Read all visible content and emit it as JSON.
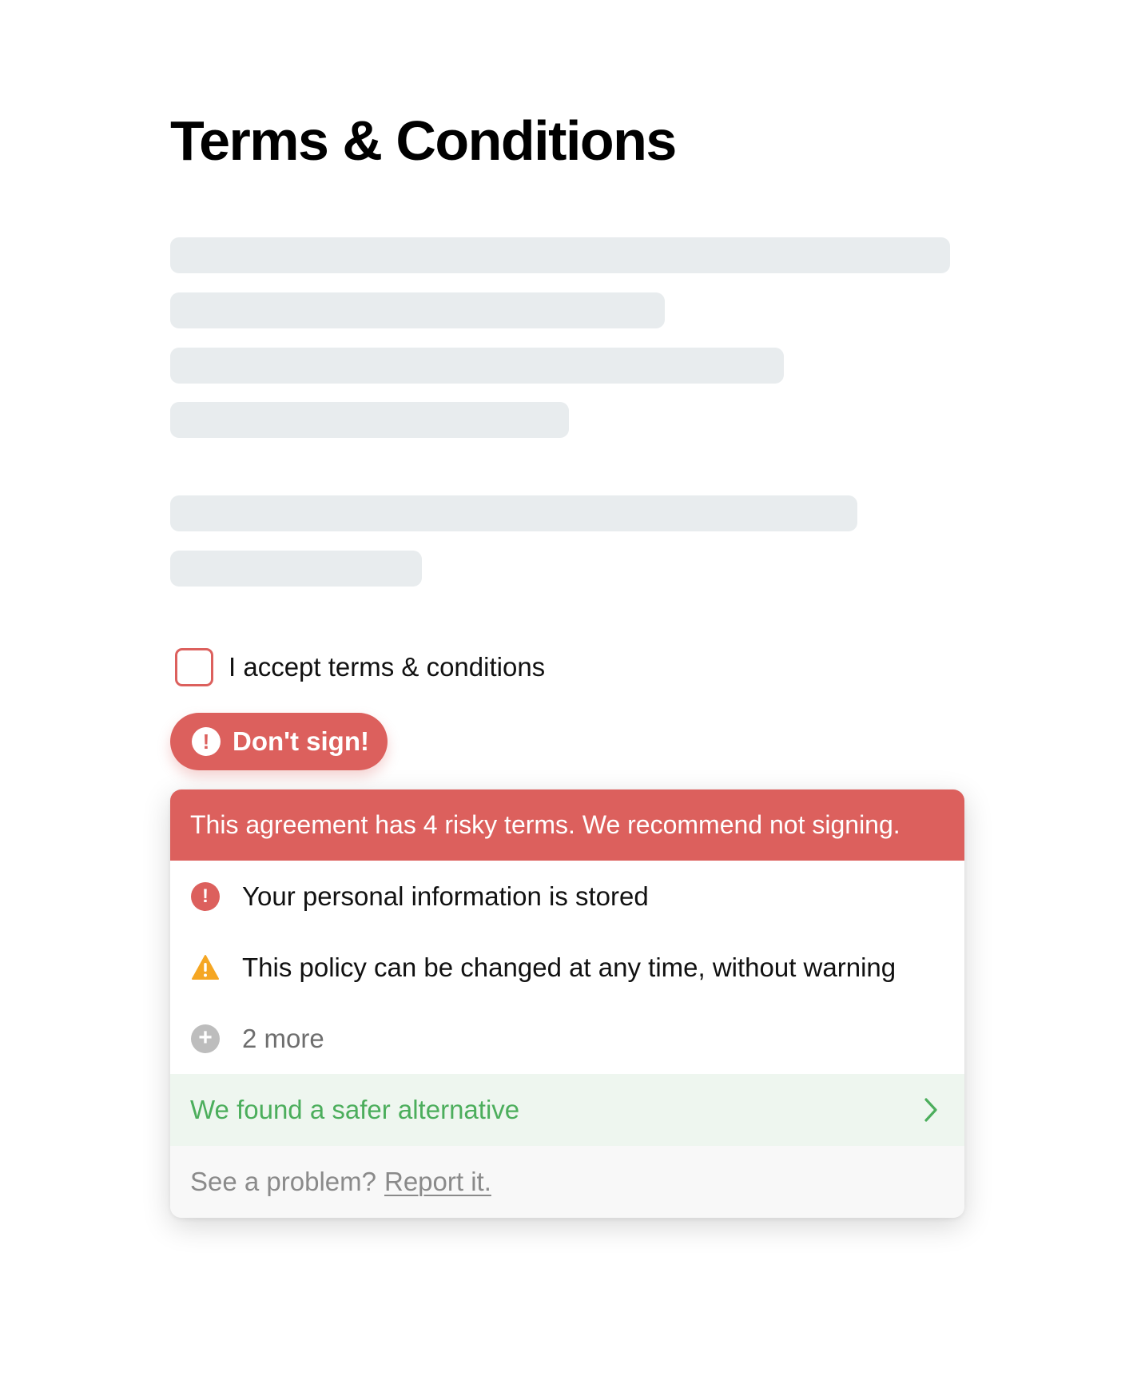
{
  "page": {
    "title": "Terms & Conditions"
  },
  "accept": {
    "label": "I accept terms & conditions",
    "checked": false
  },
  "warning_button": {
    "icon": "alert-icon",
    "label": "Don't sign!"
  },
  "popup": {
    "header": "This agreement has 4 risky terms. We recommend not signing.",
    "items": [
      {
        "icon": "alert-icon",
        "label": "Your personal information is stored"
      },
      {
        "icon": "warning-icon",
        "label": "This policy can be changed at any time, without warning"
      },
      {
        "icon": "plus-icon",
        "label": "2 more"
      }
    ],
    "alternative": {
      "label": "We found a safer alternative",
      "icon": "chevron-right-icon"
    },
    "report": {
      "prompt": "See a problem?",
      "link": "Report it."
    }
  },
  "colors": {
    "danger": "#dc605d",
    "warning": "#f5a623",
    "success": "#4cae5c",
    "skeleton": "#e8ecee"
  }
}
